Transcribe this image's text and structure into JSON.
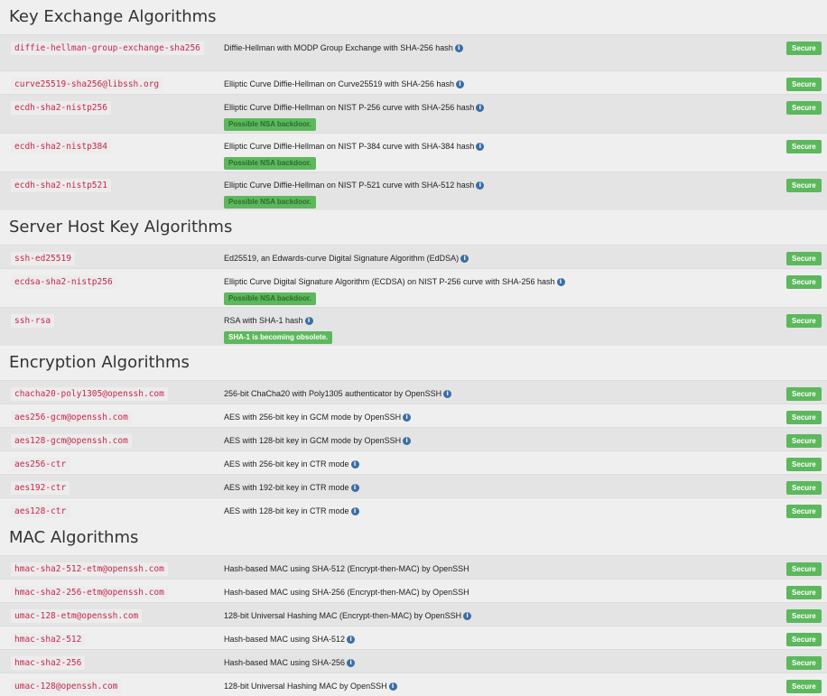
{
  "sections": [
    {
      "id": "kex",
      "title": "Key Exchange Algorithms",
      "rows": [
        {
          "name": "diffie-hellman-group-exchange-sha256",
          "desc": "Diffie-Hellman with MODP Group Exchange with SHA-256 hash",
          "info": true,
          "warning": "",
          "status": "Secure"
        },
        {
          "name": "curve25519-sha256@libssh.org",
          "desc": "Elliptic Curve Diffie-Hellman on Curve25519 with SHA-256 hash",
          "info": true,
          "warning": "",
          "status": "Secure"
        },
        {
          "name": "ecdh-sha2-nistp256",
          "desc": "Elliptic Curve Diffie-Hellman on NIST P-256 curve with SHA-256 hash",
          "info": true,
          "warning": "Possible NSA backdoor.",
          "status": "Secure"
        },
        {
          "name": "ecdh-sha2-nistp384",
          "desc": "Elliptic Curve Diffie-Hellman on NIST P-384 curve with SHA-384 hash",
          "info": true,
          "warning": "Possible NSA backdoor.",
          "status": "Secure"
        },
        {
          "name": "ecdh-sha2-nistp521",
          "desc": "Elliptic Curve Diffie-Hellman on NIST P-521 curve with SHA-512 hash",
          "info": true,
          "warning": "Possible NSA backdoor.",
          "status": "Secure"
        }
      ]
    },
    {
      "id": "hostkey",
      "title": "Server Host Key Algorithms",
      "rows": [
        {
          "name": "ssh-ed25519",
          "desc": "Ed25519, an Edwards-curve Digital Signature Algorithm (EdDSA)",
          "info": true,
          "warning": "",
          "status": "Secure"
        },
        {
          "name": "ecdsa-sha2-nistp256",
          "desc": "Elliptic Curve Digital Signature Algorithm (ECDSA) on NIST P-256 curve with SHA-256 hash",
          "info": true,
          "warning": "Possible NSA backdoor.",
          "status": "Secure"
        },
        {
          "name": "ssh-rsa",
          "desc": "RSA with SHA-1 hash",
          "info": true,
          "warning": "SHA-1 is becoming obsolete.",
          "status": "Secure"
        }
      ]
    },
    {
      "id": "enc",
      "title": "Encryption Algorithms",
      "rows": [
        {
          "name": "chacha20-poly1305@openssh.com",
          "desc": "256-bit ChaCha20 with Poly1305 authenticator by OpenSSH",
          "info": true,
          "warning": "",
          "status": "Secure"
        },
        {
          "name": "aes256-gcm@openssh.com",
          "desc": "AES with 256-bit key in GCM mode by OpenSSH",
          "info": true,
          "warning": "",
          "status": "Secure"
        },
        {
          "name": "aes128-gcm@openssh.com",
          "desc": "AES with 128-bit key in GCM mode by OpenSSH",
          "info": true,
          "warning": "",
          "status": "Secure"
        },
        {
          "name": "aes256-ctr",
          "desc": "AES with 256-bit key in CTR mode",
          "info": true,
          "warning": "",
          "status": "Secure"
        },
        {
          "name": "aes192-ctr",
          "desc": "AES with 192-bit key in CTR mode",
          "info": true,
          "warning": "",
          "status": "Secure"
        },
        {
          "name": "aes128-ctr",
          "desc": "AES with 128-bit key in CTR mode",
          "info": true,
          "warning": "",
          "status": "Secure"
        }
      ]
    },
    {
      "id": "mac",
      "title": "MAC Algorithms",
      "rows": [
        {
          "name": "hmac-sha2-512-etm@openssh.com",
          "desc": "Hash-based MAC using SHA-512 (Encrypt-then-MAC) by OpenSSH",
          "info": false,
          "warning": "",
          "status": "Secure"
        },
        {
          "name": "hmac-sha2-256-etm@openssh.com",
          "desc": "Hash-based MAC using SHA-256 (Encrypt-then-MAC) by OpenSSH",
          "info": false,
          "warning": "",
          "status": "Secure"
        },
        {
          "name": "umac-128-etm@openssh.com",
          "desc": "128-bit Universal Hashing MAC (Encrypt-then-MAC) by OpenSSH",
          "info": true,
          "warning": "",
          "status": "Secure"
        },
        {
          "name": "hmac-sha2-512",
          "desc": "Hash-based MAC using SHA-512",
          "info": true,
          "warning": "",
          "status": "Secure"
        },
        {
          "name": "hmac-sha2-256",
          "desc": "Hash-based MAC using SHA-256",
          "info": true,
          "warning": "",
          "status": "Secure"
        },
        {
          "name": "umac-128@openssh.com",
          "desc": "128-bit Universal Hashing MAC by OpenSSH",
          "info": true,
          "warning": "",
          "status": "Secure"
        }
      ]
    }
  ],
  "icons": {
    "info": "info-icon"
  },
  "colors": {
    "secure": "#5cb85c",
    "code_text": "#c7254e",
    "info": "#3b6ea5"
  }
}
